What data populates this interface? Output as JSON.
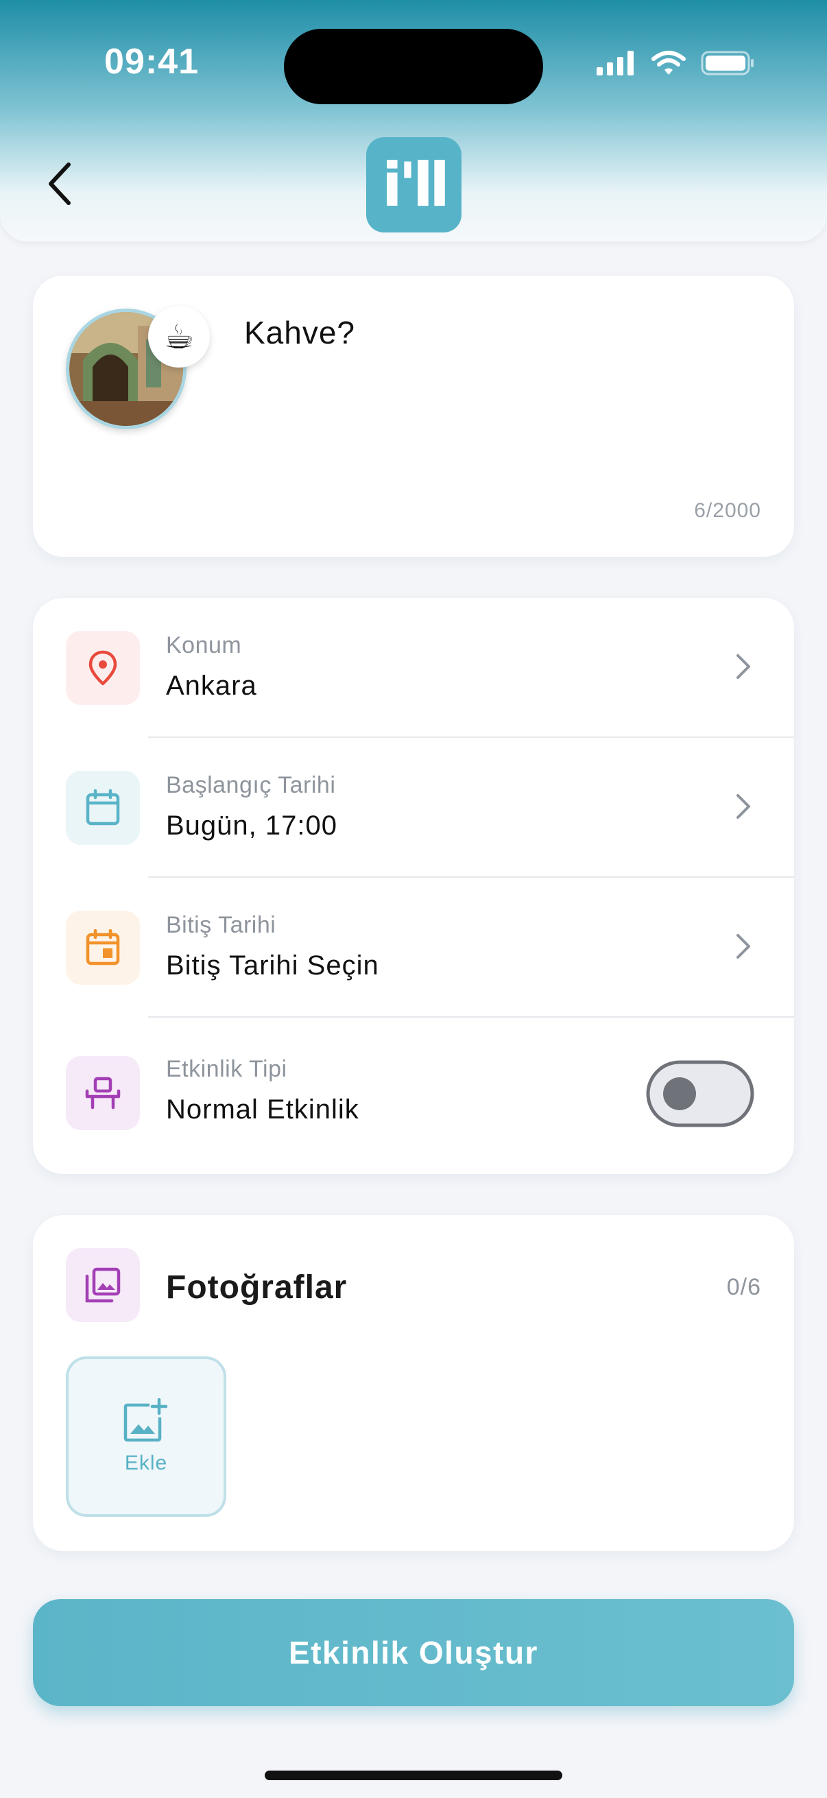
{
  "status_bar": {
    "time": "09:41"
  },
  "header": {
    "logo_text": "i'll"
  },
  "post": {
    "text": "Kahve?",
    "emoji": "☕",
    "char_counter": "6/2000"
  },
  "details": [
    {
      "label": "Konum",
      "value": "Ankara",
      "icon": "location-pin-icon",
      "color": "#e84a3c",
      "bg": "#fdeeed"
    },
    {
      "label": "Başlangıç Tarihi",
      "value": "Bugün, 17:00",
      "icon": "calendar-icon",
      "color": "#59b4c8",
      "bg": "#eaf5f8"
    },
    {
      "label": "Bitiş Tarihi",
      "value": "Bitiş Tarihi Seçin",
      "icon": "calendar-event-icon",
      "color": "#f2922a",
      "bg": "#fef3e8"
    },
    {
      "label": "Etkinlik Tipi",
      "value": "Normal Etkinlik",
      "icon": "chair-icon",
      "color": "#a33fb5",
      "bg": "#f6e9f8"
    }
  ],
  "event_type_toggle": {
    "on": false
  },
  "photos": {
    "title": "Fotoğraflar",
    "count": "0/6",
    "add_label": "Ekle",
    "icon_color": "#a33fb5",
    "icon_bg": "#f6e9f8"
  },
  "submit": {
    "label": "Etkinlik Oluştur"
  }
}
